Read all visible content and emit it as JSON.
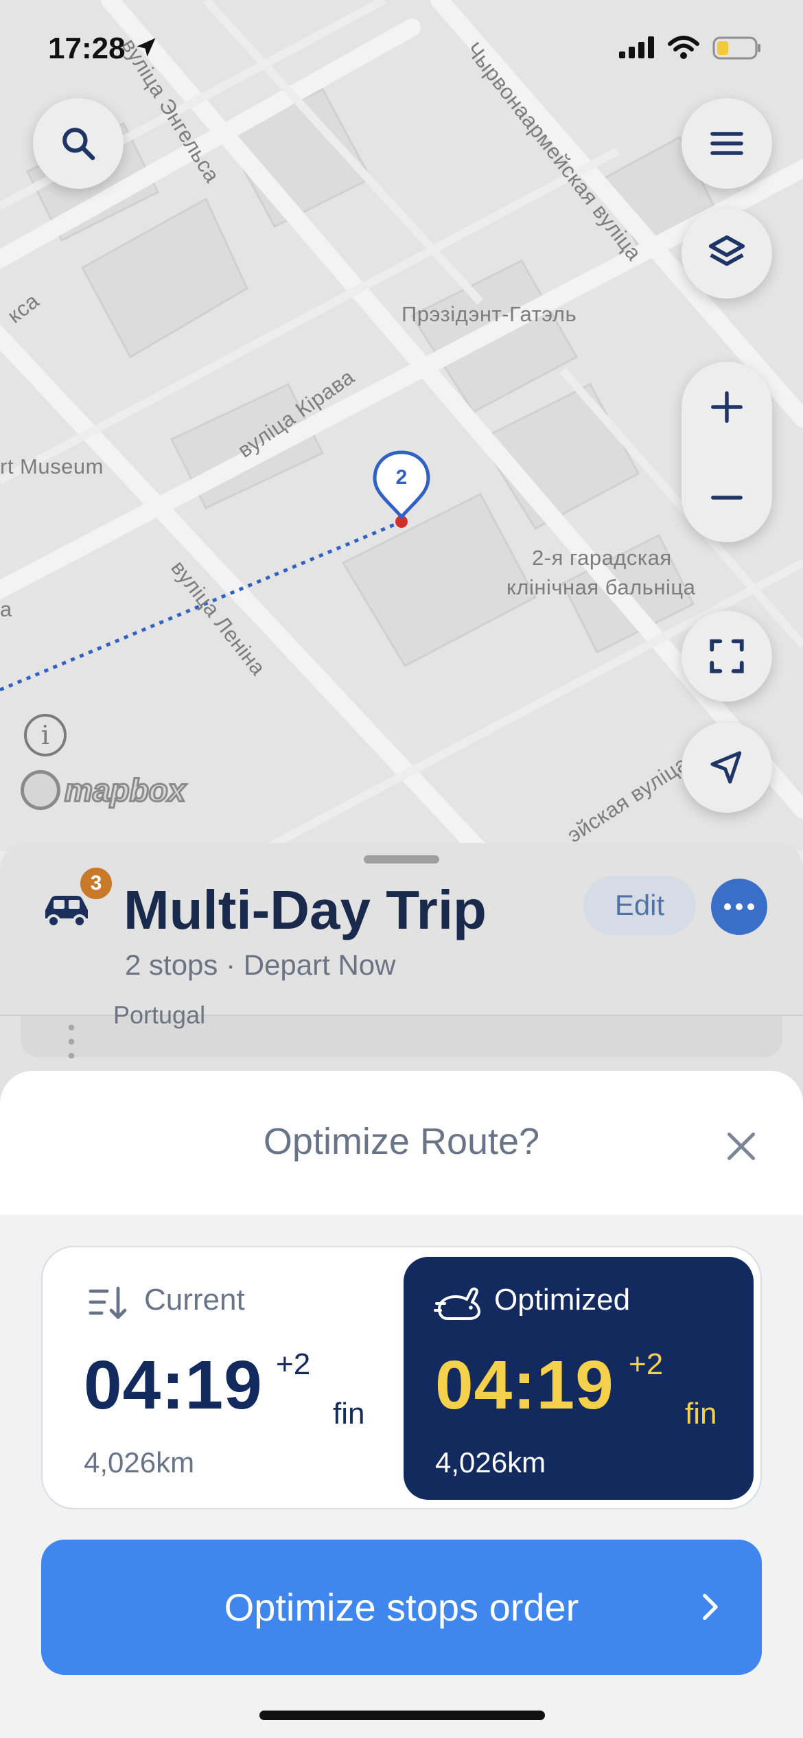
{
  "status": {
    "time": "17:28"
  },
  "map": {
    "labels": {
      "engelsa": "вуліца Энгельса",
      "chyrvonaarm": "Чырвонаармейская вуліца",
      "ksa": "кса",
      "prezident": "Прэзідэнт-Гатэль",
      "kirava": "вуліца Кірава",
      "museum": "rt Museum",
      "lenina": "вуліца Леніна",
      "hospital_1": "2-я гарадская",
      "hospital_2": "клінічная бальніца",
      "a": "a",
      "yskaya": "эйская вуліца"
    },
    "marker_number": "2",
    "attribution": "mapbox",
    "buttons": [
      "search-icon",
      "menu-icon",
      "layers-icon",
      "zoom-in-icon",
      "zoom-out-icon",
      "fit-bounds-icon",
      "locate-icon",
      "info-icon"
    ]
  },
  "trip": {
    "badge": "3",
    "title": "Multi-Day Trip",
    "subtitle": "2 stops · Depart Now",
    "edit_label": "Edit",
    "stop_preview": "Portugal"
  },
  "sheet": {
    "title": "Optimize Route?",
    "current": {
      "label": "Current",
      "time": "04:19",
      "days": "+2",
      "suffix": "fin",
      "distance": "4,026km"
    },
    "optimized": {
      "label": "Optimized",
      "time": "04:19",
      "days": "+2",
      "suffix": "fin",
      "distance": "4,026km"
    },
    "action_label": "Optimize stops order"
  },
  "colors": {
    "accent": "#3f86ef",
    "navy": "#132a5e",
    "highlight": "#f5d04a",
    "route": "#2f62c4"
  }
}
